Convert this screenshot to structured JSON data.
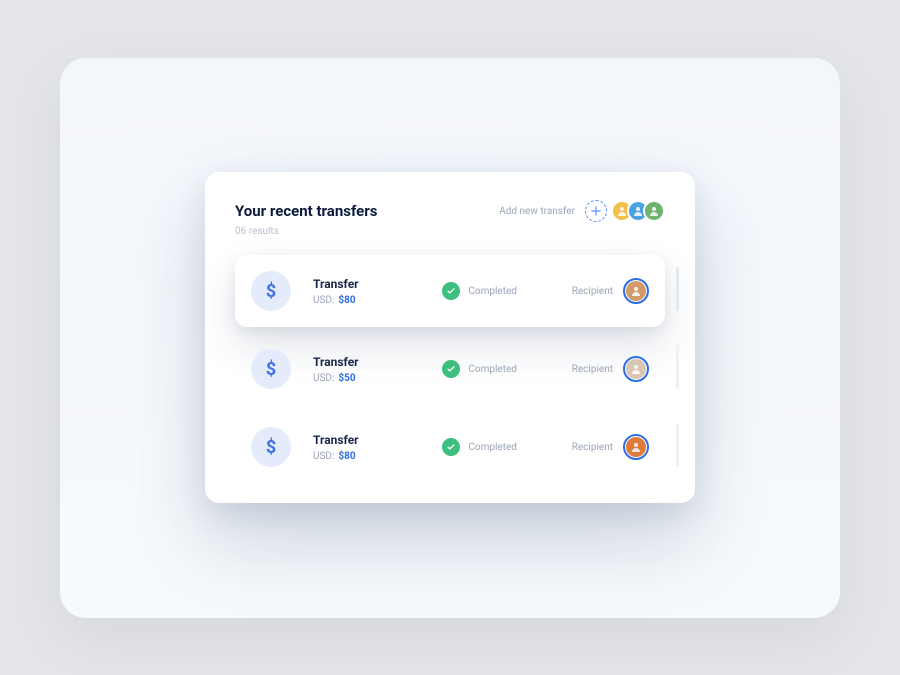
{
  "header": {
    "title": "Your recent transfers",
    "results_label": "06 results",
    "add_label": "Add new transfer"
  },
  "icons": {
    "dollar": "$"
  },
  "people": [
    {
      "bg": "#f3c14b"
    },
    {
      "bg": "#4aa3e0"
    },
    {
      "bg": "#6fb36f"
    }
  ],
  "transfers": [
    {
      "title": "Transfer",
      "currency_label": "USD:",
      "amount": "$80",
      "status": "Completed",
      "recipient_label": "Recipient",
      "recipient_bg": "#d39a6a",
      "elevated": true
    },
    {
      "title": "Transfer",
      "currency_label": "USD:",
      "amount": "$50",
      "status": "Completed",
      "recipient_label": "Recipient",
      "recipient_bg": "#d9c7b4",
      "elevated": false
    },
    {
      "title": "Transfer",
      "currency_label": "USD:",
      "amount": "$80",
      "status": "Completed",
      "recipient_label": "Recipient",
      "recipient_bg": "#e07a3f",
      "elevated": false
    }
  ]
}
